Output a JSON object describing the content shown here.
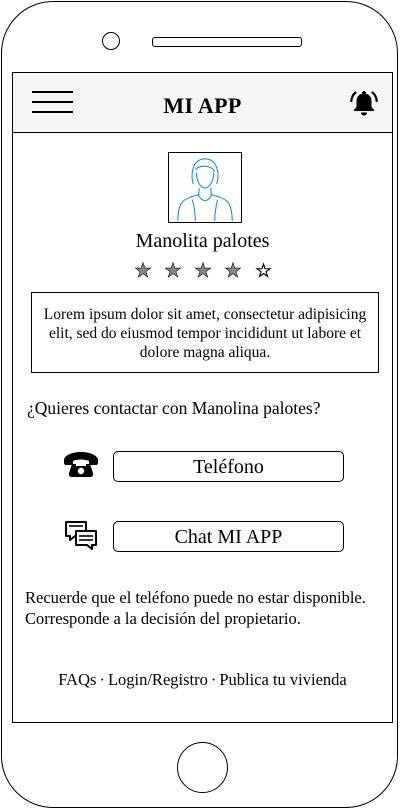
{
  "header": {
    "title": "MI APP",
    "menu_icon": "hamburger-menu-icon",
    "notification_icon": "bell-icon"
  },
  "profile": {
    "name": "Manolita palotes",
    "rating": 4,
    "rating_max": 5,
    "stars": [
      "★",
      "★",
      "★",
      "★",
      "☆"
    ],
    "description": "Lorem ipsum dolor sit amet, consectetur adipisicing elit, sed do eiusmod tempor incididunt ut labore et dolore magna aliqua."
  },
  "contact": {
    "question": "¿Quieres contactar con Manolina palotes?",
    "phone_label": "Teléfono",
    "chat_label": "Chat MI APP",
    "phone_icon": "telephone-icon",
    "chat_icon": "chat-bubbles-icon"
  },
  "notice": "Recuerde que el teléfono puede no estar disponible. Corresponde a la decisión del propietario.",
  "footer": {
    "links": [
      "FAQs",
      "Login/Registro",
      "Publica tu vivienda"
    ],
    "separator": "·"
  },
  "colors": {
    "appbar_background": "#f5f5f5",
    "avatar_stroke": "#1a8fd6",
    "star_fill": "#888888"
  }
}
